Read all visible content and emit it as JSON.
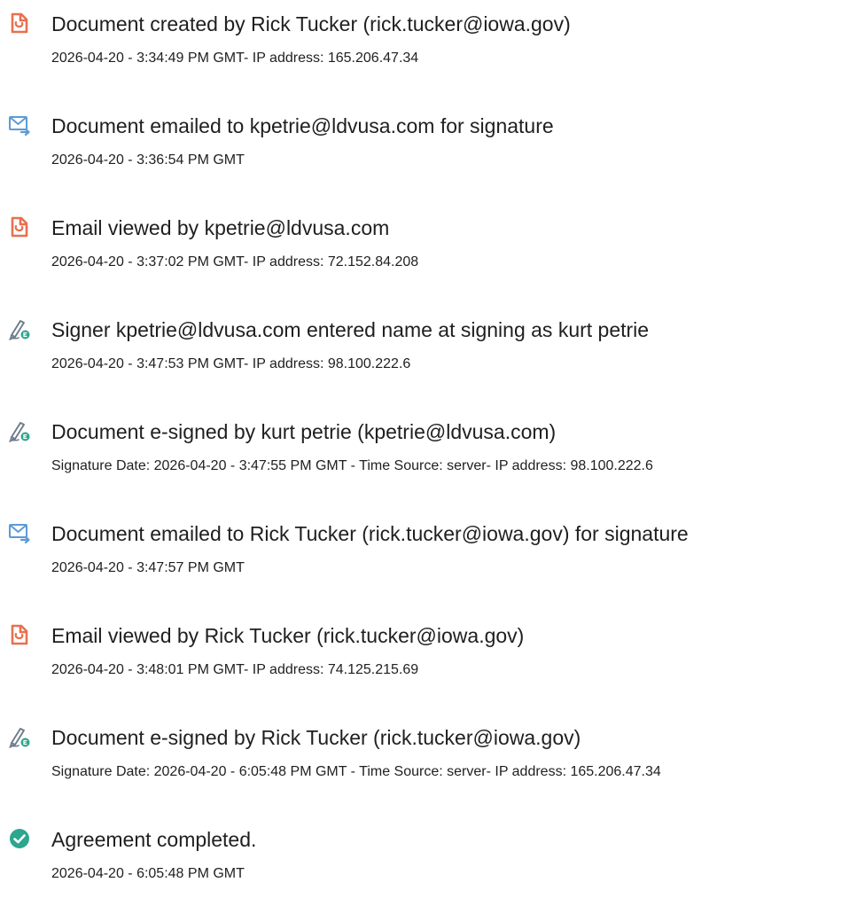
{
  "colors": {
    "doc_icon": "#e8704f",
    "mail_icon": "#5c9bd6",
    "sign_icon": "#6e7b8a",
    "sign_badge": "#2ca68e",
    "check_icon": "#2ca68e",
    "text": "#1f1f1f"
  },
  "events": [
    {
      "icon": "document-icon",
      "title": "Document created by Rick Tucker (rick.tucker@iowa.gov)",
      "detail": "2026-04-20 - 3:34:49 PM GMT- IP address: 165.206.47.34"
    },
    {
      "icon": "email-sent-icon",
      "title": "Document emailed to kpetrie@ldvusa.com for signature",
      "detail": "2026-04-20 - 3:36:54 PM GMT"
    },
    {
      "icon": "document-icon",
      "title": "Email viewed by kpetrie@ldvusa.com",
      "detail": "2026-04-20 - 3:37:02 PM GMT- IP address: 72.152.84.208"
    },
    {
      "icon": "e-sign-icon",
      "title": "Signer kpetrie@ldvusa.com entered name at signing as kurt petrie",
      "detail": "2026-04-20 - 3:47:53 PM GMT- IP address: 98.100.222.6"
    },
    {
      "icon": "e-sign-icon",
      "title": "Document e-signed by kurt petrie (kpetrie@ldvusa.com)",
      "detail": "Signature Date: 2026-04-20 - 3:47:55 PM GMT - Time Source: server- IP address: 98.100.222.6"
    },
    {
      "icon": "email-sent-icon",
      "title": "Document emailed to Rick Tucker (rick.tucker@iowa.gov) for signature",
      "detail": "2026-04-20 - 3:47:57 PM GMT"
    },
    {
      "icon": "document-icon",
      "title": "Email viewed by Rick Tucker (rick.tucker@iowa.gov)",
      "detail": "2026-04-20 - 3:48:01 PM GMT- IP address: 74.125.215.69"
    },
    {
      "icon": "e-sign-icon",
      "title": "Document e-signed by Rick Tucker (rick.tucker@iowa.gov)",
      "detail": "Signature Date: 2026-04-20 - 6:05:48 PM GMT - Time Source: server- IP address: 165.206.47.34"
    },
    {
      "icon": "check-circle-icon",
      "title": "Agreement completed.",
      "detail": "2026-04-20 - 6:05:48 PM GMT"
    }
  ]
}
